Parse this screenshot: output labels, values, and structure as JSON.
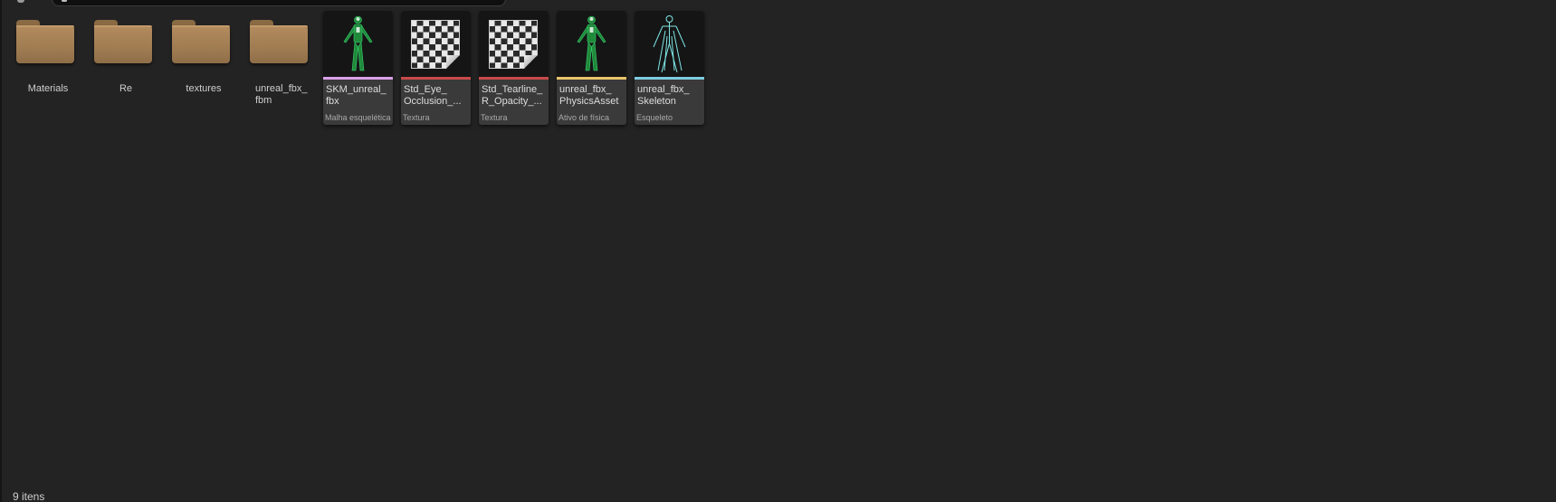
{
  "folders": [
    {
      "label": "Materials"
    },
    {
      "label": "Re"
    },
    {
      "label": "textures"
    },
    {
      "label": "unreal_fbx_\nfbm"
    }
  ],
  "assets": [
    {
      "name": "SKM_unreal_\nfbx",
      "type": "Malha esquelética",
      "strip_color": "#d9a0e8",
      "icon": "green-character-icon"
    },
    {
      "name": "Std_Eye_\nOcclusion_...",
      "type": "Textura",
      "strip_color": "#c84a4a",
      "icon": "checker-texture-icon"
    },
    {
      "name": "Std_Tearline_\nR_Opacity_...",
      "type": "Textura",
      "strip_color": "#c84a4a",
      "icon": "checker-texture-icon"
    },
    {
      "name": "unreal_fbx_\nPhysicsAsset",
      "type": "Ativo de física",
      "strip_color": "#e8c46a",
      "icon": "green-character-icon"
    },
    {
      "name": "unreal_fbx_\nSkeleton",
      "type": "Esqueleto",
      "strip_color": "#7ecbe0",
      "icon": "cyan-skeleton-icon"
    }
  ],
  "status": {
    "item_count": "9 itens"
  }
}
